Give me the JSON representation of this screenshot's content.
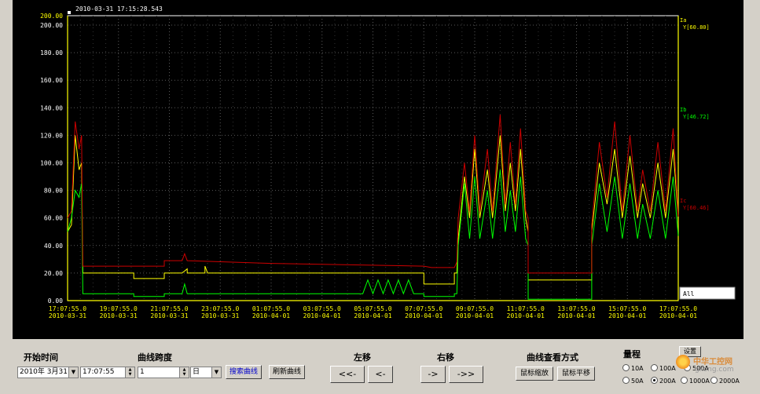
{
  "chart_data": {
    "type": "line",
    "timestamp": "2010-03-31 17:15:28.543",
    "y_ticks": [
      "200.00",
      "180.00",
      "160.00",
      "140.00",
      "120.00",
      "100.00",
      "80.00",
      "60.00",
      "40.00",
      "20.00",
      "0.00"
    ],
    "y_top_label": "200.00",
    "ylim": [
      0,
      200
    ],
    "x_ticks": [
      {
        "time": "17:07:55.0",
        "date": "2010-03-31"
      },
      {
        "time": "19:07:55.0",
        "date": "2010-03-31"
      },
      {
        "time": "21:07:55.0",
        "date": "2010-03-31"
      },
      {
        "time": "23:07:55.0",
        "date": "2010-03-31"
      },
      {
        "time": "01:07:55.0",
        "date": "2010-04-01"
      },
      {
        "time": "03:07:55.0",
        "date": "2010-04-01"
      },
      {
        "time": "05:07:55.0",
        "date": "2010-04-01"
      },
      {
        "time": "07:07:55.0",
        "date": "2010-04-01"
      },
      {
        "time": "09:07:55.0",
        "date": "2010-04-01"
      },
      {
        "time": "11:07:55.0",
        "date": "2010-04-01"
      },
      {
        "time": "13:07:55.0",
        "date": "2010-04-01"
      },
      {
        "time": "15:07:55.0",
        "date": "2010-04-01"
      },
      {
        "time": "17:07:55.0",
        "date": "2010-04-01"
      }
    ],
    "x_hours": [
      0,
      2,
      4,
      6,
      8,
      10,
      12,
      14,
      16,
      18,
      20,
      22,
      24
    ],
    "grid": true,
    "series": [
      {
        "name": "Ia",
        "value_label": "Y[60.80]",
        "color": "#ffff00",
        "points": [
          [
            0,
            50
          ],
          [
            0.15,
            55
          ],
          [
            0.3,
            120
          ],
          [
            0.45,
            95
          ],
          [
            0.55,
            100
          ],
          [
            0.6,
            20
          ],
          [
            2.6,
            20
          ],
          [
            2.6,
            16
          ],
          [
            3.8,
            16
          ],
          [
            3.8,
            20
          ],
          [
            4.5,
            20
          ],
          [
            4.7,
            23
          ],
          [
            4.7,
            20
          ],
          [
            5.4,
            20
          ],
          [
            5.4,
            25
          ],
          [
            5.5,
            20
          ],
          [
            8,
            20
          ],
          [
            14,
            20
          ],
          [
            14,
            12
          ],
          [
            15.2,
            12
          ],
          [
            15.2,
            20
          ],
          [
            15.3,
            20
          ],
          [
            15.35,
            45
          ],
          [
            15.6,
            90
          ],
          [
            15.8,
            60
          ],
          [
            16,
            110
          ],
          [
            16.2,
            60
          ],
          [
            16.5,
            95
          ],
          [
            16.7,
            60
          ],
          [
            17,
            120
          ],
          [
            17.2,
            65
          ],
          [
            17.4,
            100
          ],
          [
            17.6,
            65
          ],
          [
            17.8,
            110
          ],
          [
            18,
            60
          ],
          [
            18.1,
            50
          ],
          [
            18.1,
            15
          ],
          [
            20.6,
            15
          ],
          [
            20.6,
            50
          ],
          [
            20.9,
            100
          ],
          [
            21.2,
            70
          ],
          [
            21.5,
            110
          ],
          [
            21.8,
            60
          ],
          [
            22.1,
            105
          ],
          [
            22.4,
            60
          ],
          [
            22.6,
            85
          ],
          [
            22.9,
            60
          ],
          [
            23.2,
            100
          ],
          [
            23.5,
            60
          ],
          [
            23.8,
            110
          ],
          [
            24,
            60
          ]
        ]
      },
      {
        "name": "Ib",
        "value_label": "Y[46.72]",
        "color": "#00ff00",
        "points": [
          [
            0,
            50
          ],
          [
            0.15,
            60
          ],
          [
            0.3,
            80
          ],
          [
            0.45,
            75
          ],
          [
            0.55,
            85
          ],
          [
            0.6,
            5
          ],
          [
            2.6,
            5
          ],
          [
            2.6,
            3
          ],
          [
            3.8,
            3
          ],
          [
            3.8,
            5
          ],
          [
            4.5,
            5
          ],
          [
            4.6,
            12
          ],
          [
            4.7,
            5
          ],
          [
            8,
            5
          ],
          [
            11.6,
            5
          ],
          [
            11.8,
            15
          ],
          [
            12,
            5
          ],
          [
            12.2,
            15
          ],
          [
            12.4,
            5
          ],
          [
            12.6,
            15
          ],
          [
            12.8,
            5
          ],
          [
            13,
            15
          ],
          [
            13.2,
            5
          ],
          [
            13.4,
            15
          ],
          [
            13.6,
            5
          ],
          [
            14,
            5
          ],
          [
            14,
            3
          ],
          [
            15.2,
            3
          ],
          [
            15.2,
            5
          ],
          [
            15.3,
            5
          ],
          [
            15.35,
            40
          ],
          [
            15.6,
            85
          ],
          [
            15.8,
            45
          ],
          [
            16,
            90
          ],
          [
            16.2,
            45
          ],
          [
            16.5,
            80
          ],
          [
            16.7,
            45
          ],
          [
            17,
            95
          ],
          [
            17.2,
            50
          ],
          [
            17.4,
            80
          ],
          [
            17.6,
            50
          ],
          [
            17.8,
            90
          ],
          [
            18,
            45
          ],
          [
            18.1,
            40
          ],
          [
            18.1,
            1
          ],
          [
            20.6,
            1
          ],
          [
            20.6,
            40
          ],
          [
            20.9,
            85
          ],
          [
            21.2,
            50
          ],
          [
            21.5,
            90
          ],
          [
            21.8,
            45
          ],
          [
            22.1,
            85
          ],
          [
            22.4,
            45
          ],
          [
            22.6,
            70
          ],
          [
            22.9,
            45
          ],
          [
            23.2,
            80
          ],
          [
            23.5,
            45
          ],
          [
            23.8,
            90
          ],
          [
            24,
            47
          ]
        ]
      },
      {
        "name": "Ic",
        "value_label": "Y[60.46]",
        "color": "#cc0000",
        "points": [
          [
            0,
            60
          ],
          [
            0.15,
            65
          ],
          [
            0.3,
            130
          ],
          [
            0.45,
            110
          ],
          [
            0.55,
            120
          ],
          [
            0.6,
            25
          ],
          [
            3.8,
            25
          ],
          [
            3.8,
            29
          ],
          [
            4.5,
            29
          ],
          [
            4.6,
            34
          ],
          [
            4.7,
            29
          ],
          [
            8,
            27
          ],
          [
            14,
            25
          ],
          [
            14.3,
            24
          ],
          [
            15.2,
            24
          ],
          [
            15.3,
            28
          ],
          [
            15.35,
            60
          ],
          [
            15.6,
            100
          ],
          [
            15.8,
            65
          ],
          [
            16,
            120
          ],
          [
            16.2,
            65
          ],
          [
            16.5,
            110
          ],
          [
            16.7,
            65
          ],
          [
            17,
            135
          ],
          [
            17.2,
            70
          ],
          [
            17.4,
            115
          ],
          [
            17.6,
            70
          ],
          [
            17.8,
            125
          ],
          [
            18,
            65
          ],
          [
            18.1,
            60
          ],
          [
            18.1,
            20
          ],
          [
            20.6,
            20
          ],
          [
            20.6,
            55
          ],
          [
            20.9,
            115
          ],
          [
            21.2,
            75
          ],
          [
            21.5,
            130
          ],
          [
            21.8,
            65
          ],
          [
            22.1,
            120
          ],
          [
            22.4,
            65
          ],
          [
            22.6,
            95
          ],
          [
            22.9,
            65
          ],
          [
            23.2,
            115
          ],
          [
            23.5,
            65
          ],
          [
            23.8,
            125
          ],
          [
            24,
            61
          ]
        ]
      }
    ],
    "legend_box": "All"
  },
  "controls": {
    "start_time_label": "开始时间",
    "start_date": "2010年  3月31日",
    "start_time": "17:07:55",
    "span_label": "曲线跨度",
    "span_value": "1",
    "span_unit": "日",
    "search_button": "搜索曲线",
    "refresh_button": "刷新曲线",
    "left_label": "左移",
    "left_big": "<<-",
    "left_small": "<-",
    "right_label": "右移",
    "right_small": "->",
    "right_big": "->>",
    "view_label": "曲线查看方式",
    "zoom_button": "鼠标缩放",
    "pan_button": "鼠标平移",
    "range_label": "量程",
    "settings_button": "设置",
    "ranges": [
      {
        "label": "10A",
        "selected": false
      },
      {
        "label": "100A",
        "selected": false
      },
      {
        "label": "500A",
        "selected": false
      },
      {
        "label": "50A",
        "selected": false
      },
      {
        "label": "200A",
        "selected": true
      },
      {
        "label": "1000A",
        "selected": false
      },
      {
        "label": "2000A",
        "selected": false
      }
    ]
  },
  "watermark": {
    "line1": "中华工控网",
    "line2": "gkong.com"
  }
}
